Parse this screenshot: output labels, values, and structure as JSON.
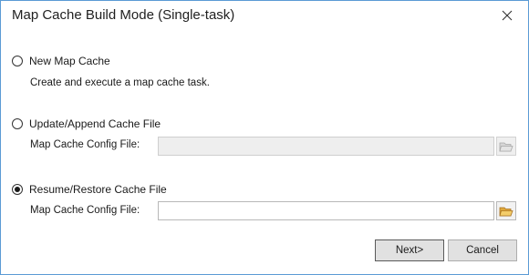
{
  "dialog": {
    "title": "Map Cache Build Mode (Single-task)"
  },
  "options": {
    "new_map_cache": {
      "label": "New Map Cache",
      "description": "Create and execute a map cache task.",
      "selected": false
    },
    "update_append": {
      "label": "Update/Append Cache File",
      "field_label": "Map Cache Config File:",
      "value": "",
      "enabled": false,
      "selected": false
    },
    "resume_restore": {
      "label": "Resume/Restore Cache File",
      "field_label": "Map Cache Config File:",
      "value": "",
      "enabled": true,
      "selected": true
    }
  },
  "buttons": {
    "next": "Next>",
    "cancel": "Cancel"
  },
  "icons": {
    "close": "close-icon",
    "browse": "folder-open-icon"
  },
  "colors": {
    "window_border": "#5b9bd5",
    "button_face": "#e1e1e1",
    "disabled_field": "#eeeeee",
    "folder_icon": "#e8b84a"
  }
}
